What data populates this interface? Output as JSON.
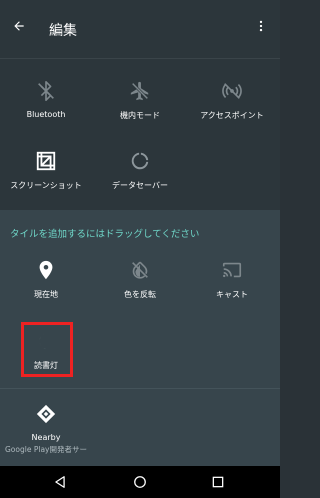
{
  "toolbar": {
    "title": "編集"
  },
  "active_tiles": [
    {
      "label": "Bluetooth",
      "icon": "bluetooth-disabled-icon"
    },
    {
      "label": "機内モード",
      "icon": "airplane-mode-icon"
    },
    {
      "label": "アクセスポイント",
      "icon": "hotspot-disabled-icon"
    },
    {
      "label": "スクリーンショット",
      "icon": "screenshot-icon"
    },
    {
      "label": "データセーバー",
      "icon": "data-saver-icon"
    }
  ],
  "drag_hint": "タイルを追加するにはドラッグしてください",
  "available_tiles": [
    {
      "label": "現在地",
      "icon": "location-icon"
    },
    {
      "label": "色を反転",
      "icon": "invert-colors-icon"
    },
    {
      "label": "キャスト",
      "icon": "cast-icon"
    },
    {
      "label": "読書灯",
      "icon": "night-light-icon"
    },
    {
      "label": "Nearby",
      "sublabel": "Google Play開発者サー",
      "icon": "nearby-icon"
    }
  ],
  "colors": {
    "accent": "#6fd6c8",
    "highlight": "#ee2222"
  }
}
